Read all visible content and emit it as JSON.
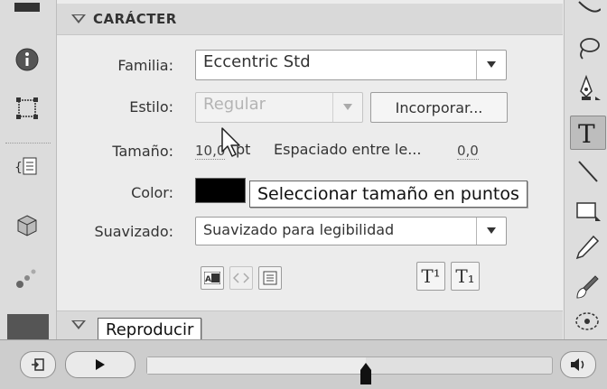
{
  "section": {
    "title": "CARÁCTER"
  },
  "fields": {
    "family_label": "Familia:",
    "family_value": "Eccentric Std",
    "style_label": "Estilo:",
    "style_value": "Regular",
    "embed_button": "Incorporar...",
    "size_label": "Tamaño:",
    "size_value": "10,0",
    "size_unit": "pt",
    "spacing_label": "Espaciado entre le...",
    "spacing_value": "0,0",
    "color_label": "Color:",
    "color_value": "#000000",
    "smoothing_label": "Suavizado:",
    "smoothing_value": "Suavizado para legibilidad"
  },
  "format_buttons": {
    "superscript": "T¹",
    "subscript": "T₁"
  },
  "tooltips": {
    "size_tooltip": "Seleccionar tamaño en puntos",
    "play_tooltip": "Reproducir"
  },
  "playback": {
    "progress_fraction": 0.54
  }
}
